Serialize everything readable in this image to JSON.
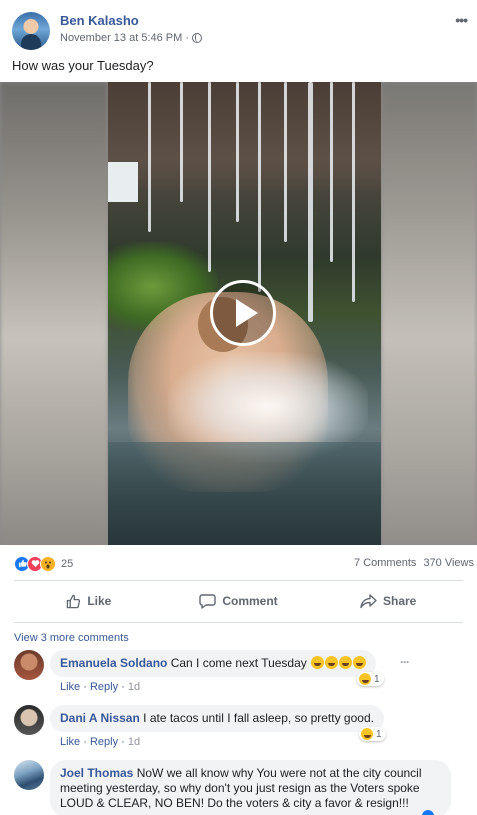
{
  "post": {
    "author": "Ben Kalasho",
    "timestamp": "November 13 at 5:46 PM · ",
    "privacy_icon": "globe-icon",
    "text": "How was your Tuesday?",
    "more_label": "•••"
  },
  "video": {
    "play_icon": "play-icon"
  },
  "stats": {
    "reaction_count": "25",
    "comments": "7 Comments",
    "views": "370 Views"
  },
  "actions": {
    "like": "Like",
    "comment": "Comment",
    "share": "Share"
  },
  "comments_section": {
    "view_more": "View 3 more comments",
    "items": [
      {
        "name": "Emanuela Soldano",
        "text": "Can I come next Tuesday",
        "like": "Like",
        "reply": "Reply",
        "time": "1d",
        "reaction_count": "1"
      },
      {
        "name": "Dani A Nissan",
        "text": "I ate tacos until I fall asleep, so pretty good.",
        "like": "Like",
        "reply": "Reply",
        "time": "1d",
        "reaction_count": "1"
      },
      {
        "name": "Joel Thomas",
        "text_line1": "NoW we all know why You were not at the city council",
        "text_line2": "meeting yesterday, so why don't you just resign as the Voters spoke",
        "text_line3": "LOUD & CLEAR, NO BEN! Do the voters & city a favor & resign!!!"
      }
    ]
  },
  "colors": {
    "link_blue": "#385898",
    "like_blue": "#1877f2",
    "love_red": "#f33e58",
    "wow_yellow": "#f7b125"
  }
}
